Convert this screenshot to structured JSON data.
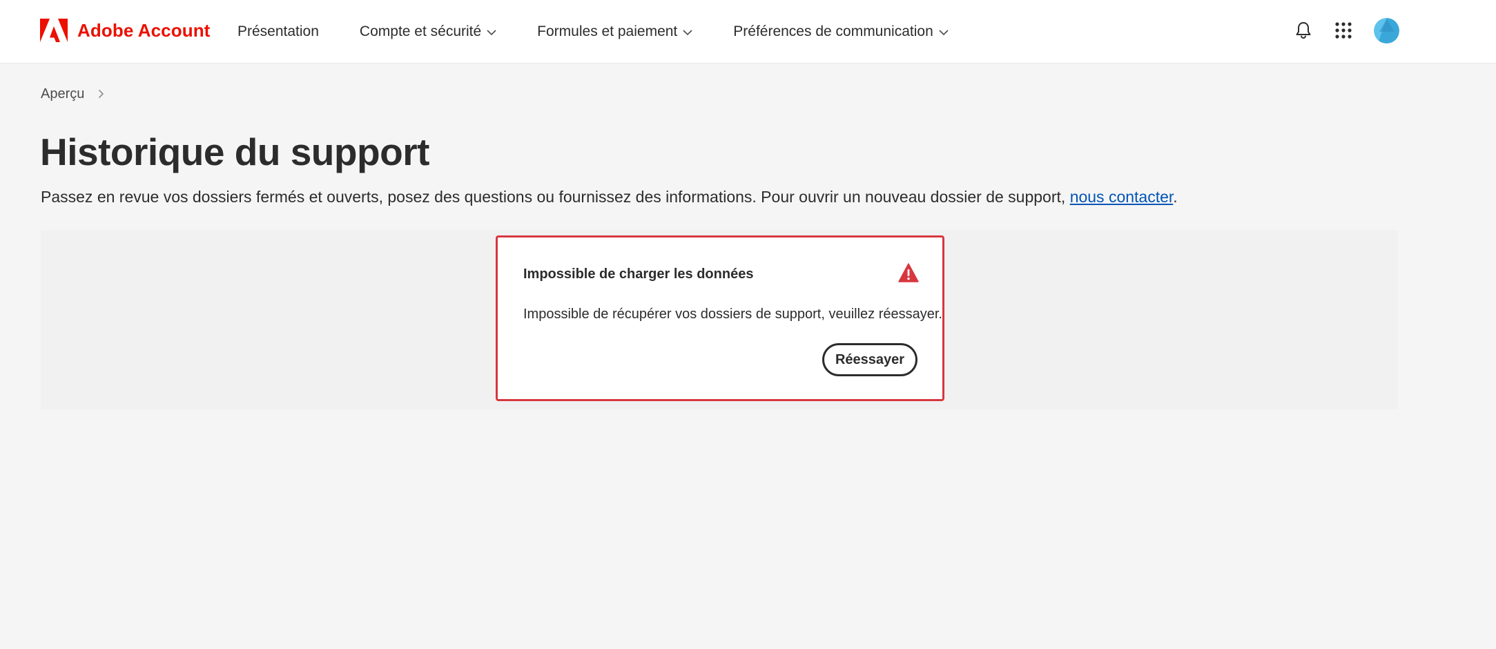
{
  "header": {
    "brand_name": "Adobe Account",
    "brand_color": "#eb1000",
    "nav": [
      {
        "label": "Présentation",
        "has_dropdown": false
      },
      {
        "label": "Compte et sécurité",
        "has_dropdown": true
      },
      {
        "label": "Formules et paiement",
        "has_dropdown": true
      },
      {
        "label": "Préférences de communication",
        "has_dropdown": true
      }
    ],
    "icons": [
      "bell-icon",
      "app-grid-icon",
      "avatar"
    ]
  },
  "breadcrumb": {
    "items": [
      "Aperçu"
    ]
  },
  "page": {
    "title": "Historique du support",
    "description_prefix": "Passez en revue vos dossiers fermés et ouverts, posez des questions ou fournissez des informations. Pour ouvrir un nouveau dossier de support, ",
    "contact_link": "nous contacter",
    "description_suffix": "."
  },
  "error": {
    "title": "Impossible de charger les données",
    "message": "Impossible de récupérer vos dossiers de support, veuillez réessayer.",
    "retry_label": "Réessayer",
    "border_color": "#d7373f",
    "icon": "warning-icon"
  }
}
